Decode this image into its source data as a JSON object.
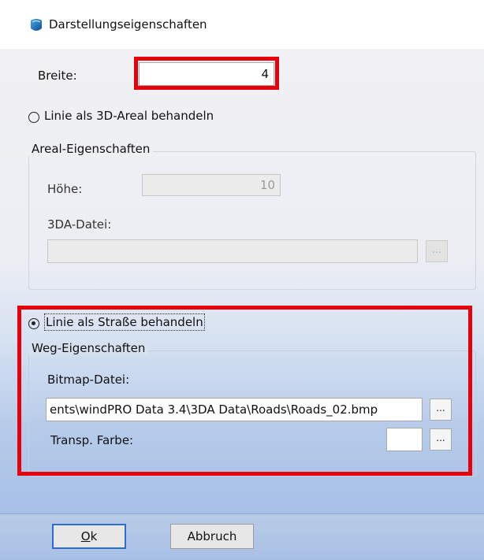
{
  "window": {
    "title": "Darstellungseigenschaften",
    "icon": "app-globe-icon"
  },
  "width_field": {
    "label": "Breite:",
    "value": "4"
  },
  "areal_option": {
    "label": "Linie als 3D-Areal behandeln",
    "checked": false
  },
  "areal_group": {
    "legend": "Areal-Eigenschaften",
    "height_label": "Höhe:",
    "height_value": "10",
    "file_label": "3DA-Datei:",
    "file_value": "",
    "browse_label": "..."
  },
  "road_option": {
    "label": "Linie als Straße behandeln",
    "checked": true
  },
  "road_group": {
    "legend": "Weg-Eigenschaften",
    "bitmap_label": "Bitmap-Datei:",
    "bitmap_value": "ents\\windPRO Data 3.4\\3DA Data\\Roads\\Roads_02.bmp",
    "bitmap_browse_label": "...",
    "transp_label": "Transp. Farbe:",
    "transp_color": "#ffffff",
    "transp_browse_label": "..."
  },
  "buttons": {
    "ok_mnemonic": "O",
    "ok_rest": "k",
    "cancel": "Abbruch"
  },
  "colors": {
    "highlight": "#e5000b",
    "default_button_border": "#2f6ccf"
  }
}
